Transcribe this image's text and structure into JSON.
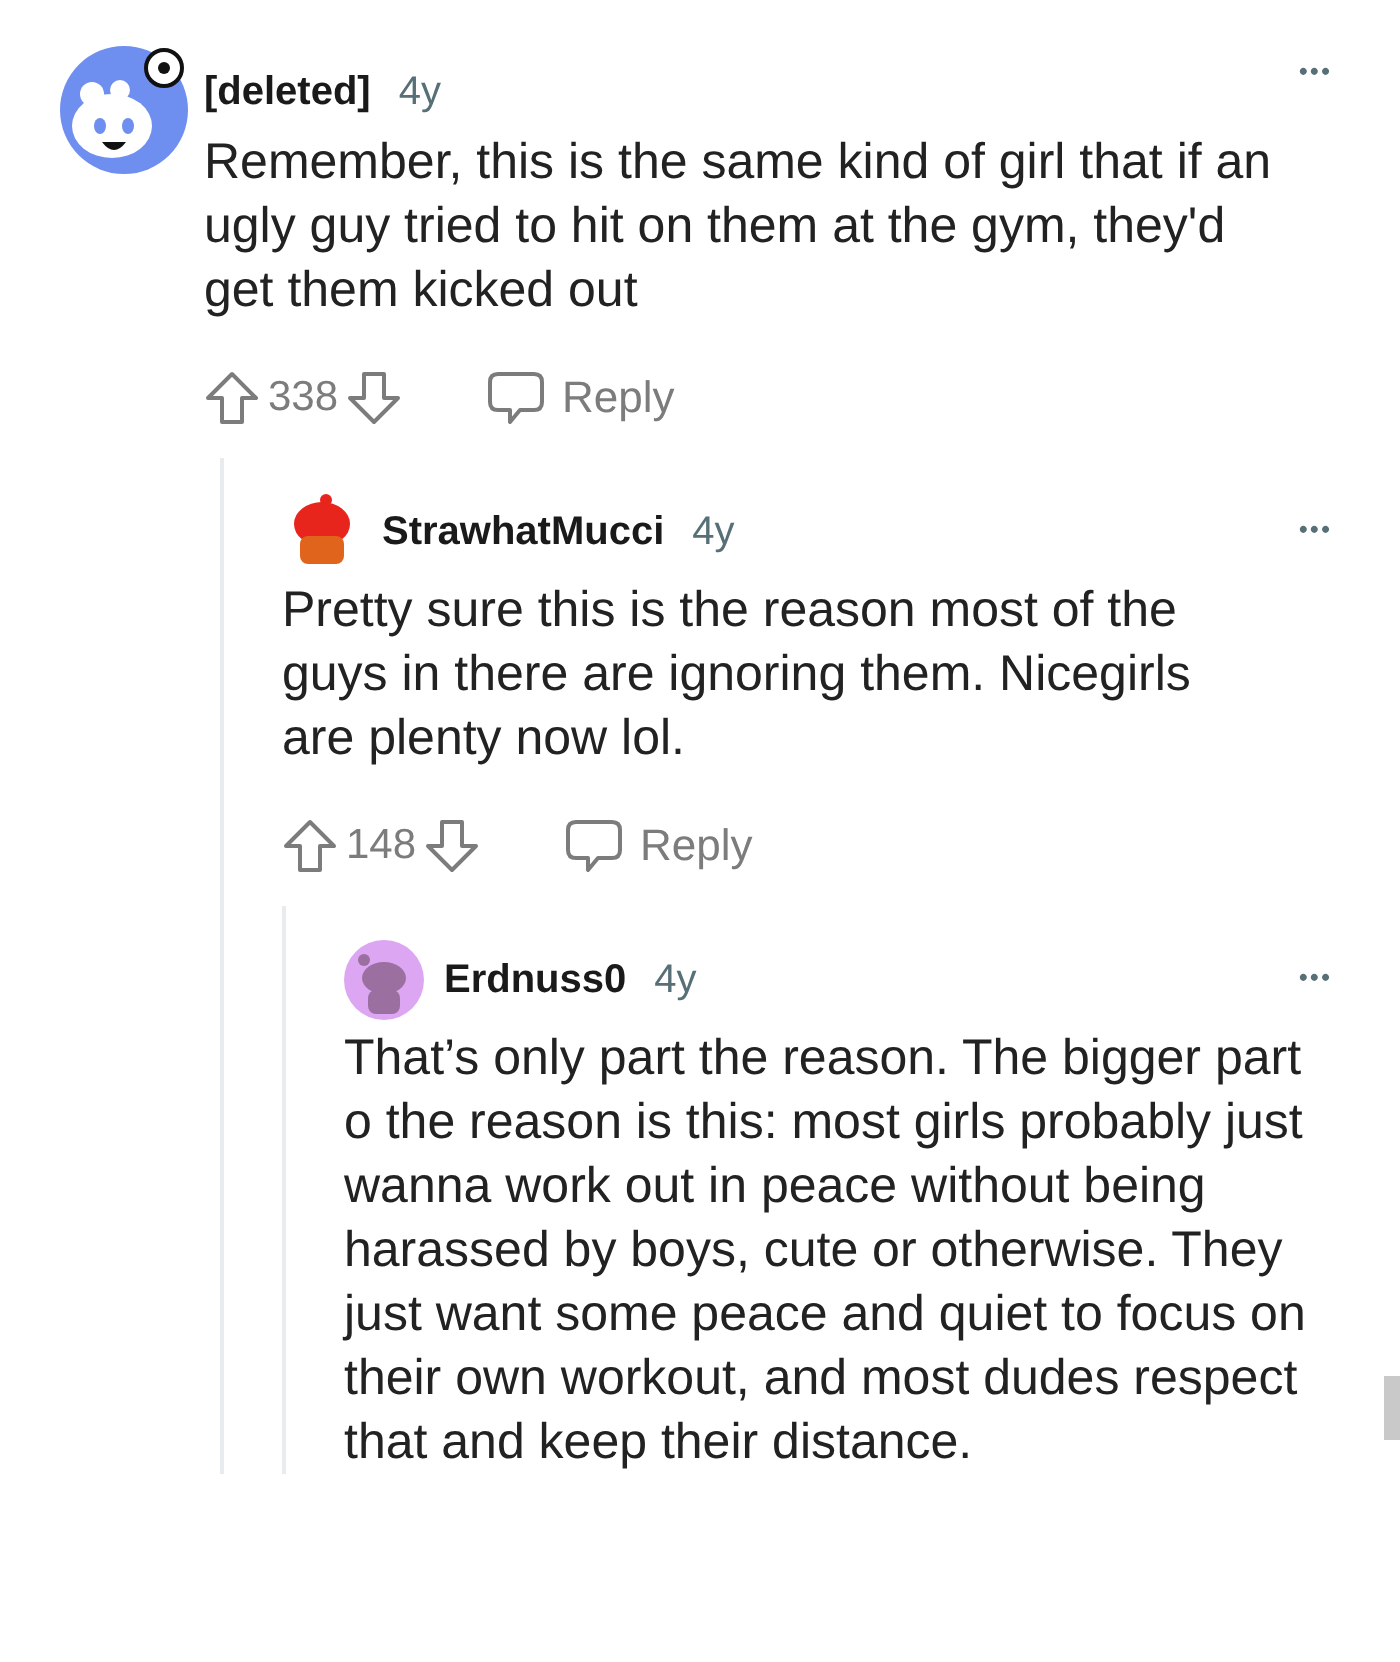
{
  "comments": [
    {
      "author": "[deleted]",
      "age": "4y",
      "color": "#6f8ff0",
      "body": "Remember, this is the same kind of girl that if an ugly guy tried to hit on them at the gym, they'd get them kicked out",
      "more": "•••",
      "score": "338",
      "reply": "Reply",
      "children": [
        {
          "author": "StrawhatMucci",
          "age": "4y",
          "color": "#e8251c",
          "body": "Pretty sure this is the reason most of the guys in there are ignoring them. Nicegirls are plenty now lol.",
          "more": "•••",
          "score": "148",
          "reply": "Reply",
          "children": [
            {
              "author": "Erdnuss0",
              "age": "4y",
              "color": "#dca6f2",
              "body": "That’s only part the reason. The bigger part o the reason is this: most girls probably just wanna work out in peace without being harassed by boys, cute or otherwise. They just want some peace and quiet to focus on their own workout, and most dudes respect that and keep their distance.",
              "more": "•••"
            }
          ]
        }
      ]
    }
  ]
}
